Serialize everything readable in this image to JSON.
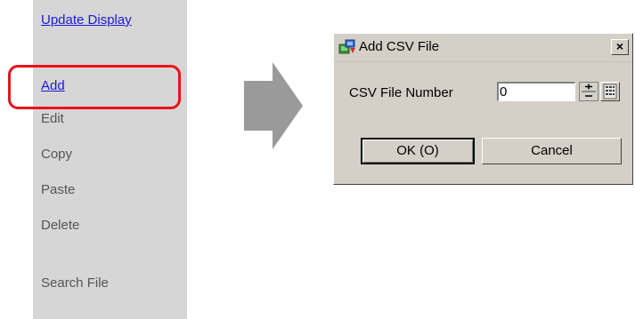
{
  "side_panel": {
    "items": [
      {
        "label": "Update Display"
      },
      {
        "label": "Add"
      },
      {
        "label": "Edit"
      },
      {
        "label": "Copy"
      },
      {
        "label": "Paste"
      },
      {
        "label": "Delete"
      },
      {
        "label": "Search File"
      }
    ]
  },
  "dialog": {
    "title": "Add CSV File",
    "close_label": "×",
    "field_label": "CSV File Number",
    "field_value": "0",
    "ok_label": "OK (O)",
    "cancel_label": "Cancel"
  },
  "colors": {
    "panel_bg": "#d6d6d6",
    "link": "#1a1adc",
    "highlight": "#e8141c",
    "dialog_bg": "#d4d0c8",
    "arrow": "#9a9a9a"
  },
  "icons": {
    "title": "app-window-icon",
    "spin": "spin-updown-icon",
    "keypad": "keypad-icon",
    "arrow": "right-arrow-icon"
  }
}
